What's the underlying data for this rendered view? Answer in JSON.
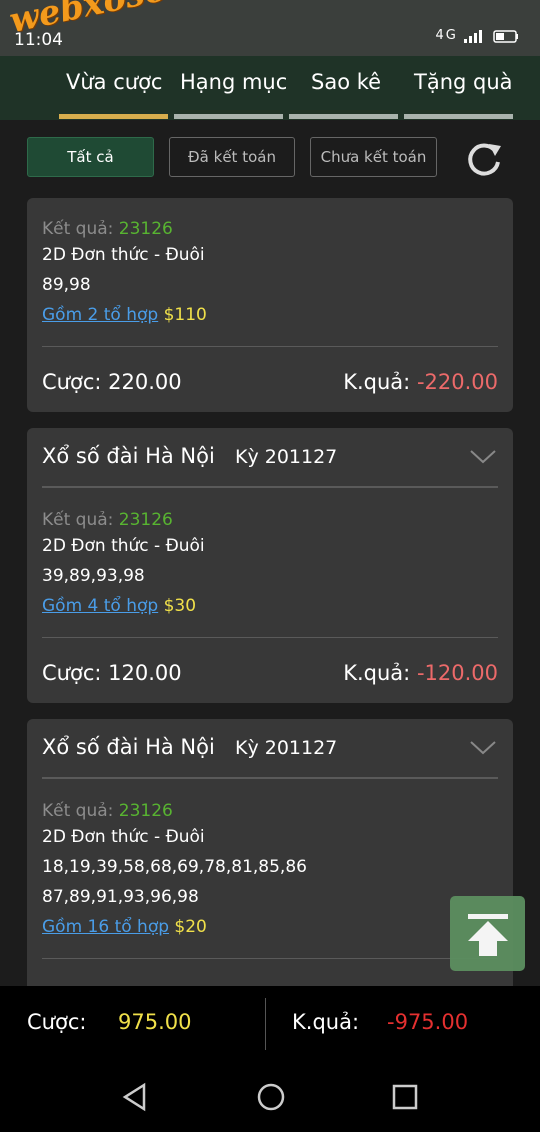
{
  "status": {
    "time": "11:04",
    "indicators": "4G"
  },
  "logo": "webxoso.net",
  "nav": {
    "tabs": [
      {
        "label": "Vừa cược",
        "active": true
      },
      {
        "label": "Hạng mục",
        "active": false
      },
      {
        "label": "Sao kê",
        "active": false
      },
      {
        "label": "Tặng quà",
        "active": false
      }
    ]
  },
  "filters": {
    "all": "Tất cả",
    "settled": "Đã kết toán",
    "unsettled": "Chưa kết toán"
  },
  "cards": [
    {
      "result_label": "Kết quả:",
      "result_value": "23126",
      "bet_type": "2D Đơn thức - Đuôi",
      "numbers": [
        "89,98"
      ],
      "combo_link": "Gồm 2 tổ hợp",
      "combo_amount": "$110",
      "bet_label": "Cược:",
      "bet_value": "220.00",
      "result_sum_label": "K.quả:",
      "result_sum_value": "-220.00"
    },
    {
      "lottery": "Xổ số đài Hà Nội",
      "period": "Kỳ 201127",
      "result_label": "Kết quả:",
      "result_value": "23126",
      "bet_type": "2D Đơn thức - Đuôi",
      "numbers": [
        "39,89,93,98"
      ],
      "combo_link": "Gồm 4 tổ hợp",
      "combo_amount": "$30",
      "bet_label": "Cược:",
      "bet_value": "120.00",
      "result_sum_label": "K.quả:",
      "result_sum_value": "-120.00"
    },
    {
      "lottery": "Xổ số đài Hà Nội",
      "period": "Kỳ 201127",
      "result_label": "Kết quả:",
      "result_value": "23126",
      "bet_type": "2D Đơn thức - Đuôi",
      "numbers": [
        "18,19,39,58,68,69,78,81,85,86",
        "87,89,91,93,96,98"
      ],
      "combo_link": "Gồm 16 tổ hợp",
      "combo_amount": "$20"
    }
  ],
  "footer": {
    "bet_label": "Cược:",
    "bet_total": "975.00",
    "result_label": "K.quả:",
    "result_total": "-975.00"
  },
  "colors": {
    "nav_bg": "#1f3327",
    "active_tab": "#d7ad4d",
    "green": "#58b431",
    "negative": "#ec6a6a",
    "footer_negative": "#e53030",
    "yellow": "#f0e04a",
    "link": "#4a9de8"
  }
}
